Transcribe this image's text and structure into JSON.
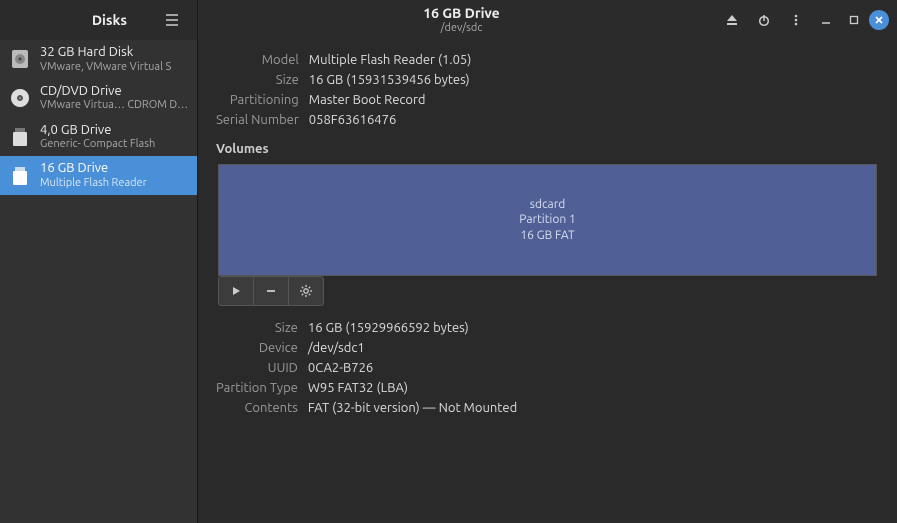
{
  "app": {
    "title": "Disks"
  },
  "headerbar": {
    "drive_title": "16 GB Drive",
    "drive_subtitle": "/dev/sdc"
  },
  "sidebar": {
    "items": [
      {
        "name": "32 GB Hard Disk",
        "desc": "VMware, VMware Virtual S",
        "icon": "hdd"
      },
      {
        "name": "CD/DVD Drive",
        "desc": "VMware Virtua… CDROM Drive",
        "icon": "optical"
      },
      {
        "name": "4,0 GB Drive",
        "desc": "Generic- Compact Flash",
        "icon": "removable"
      },
      {
        "name": "16 GB Drive",
        "desc": "Multiple Flash Reader",
        "icon": "removable"
      }
    ],
    "selected_index": 3
  },
  "drive_props": {
    "labels": {
      "model": "Model",
      "size": "Size",
      "partitioning": "Partitioning",
      "serial": "Serial Number"
    },
    "values": {
      "model": "Multiple Flash Reader (1.05)",
      "size": "16 GB (15931539456 bytes)",
      "partitioning": "Master Boot Record",
      "serial": "058F63616476"
    }
  },
  "volumes": {
    "header": "Volumes",
    "partition": {
      "name": "sdcard",
      "line2": "Partition 1",
      "line3": "16 GB FAT"
    }
  },
  "volume_props": {
    "labels": {
      "size": "Size",
      "device": "Device",
      "uuid": "UUID",
      "ptype": "Partition Type",
      "contents": "Contents"
    },
    "values": {
      "size": "16 GB (15929966592 bytes)",
      "device": "/dev/sdc1",
      "uuid": "0CA2-B726",
      "ptype": "W95 FAT32 (LBA)",
      "contents": "FAT (32-bit version) — Not Mounted"
    }
  }
}
